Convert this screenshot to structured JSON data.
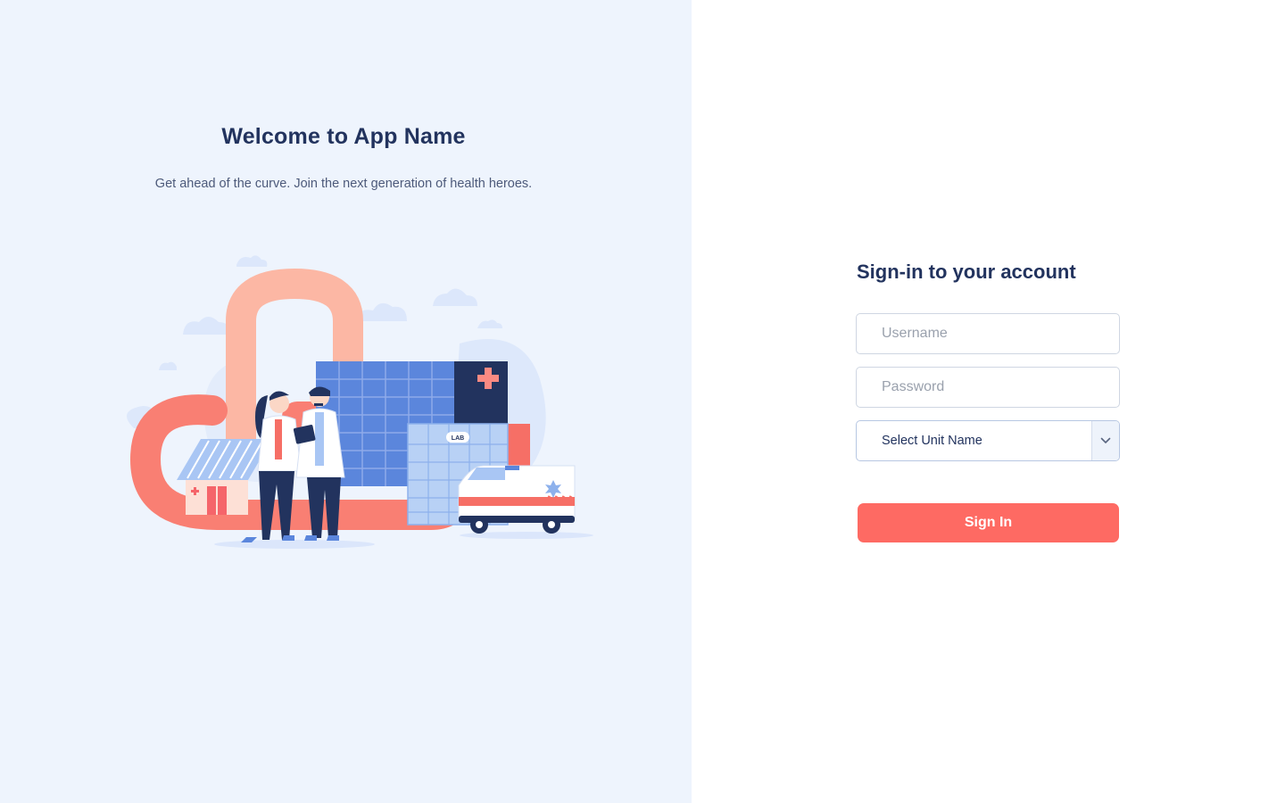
{
  "welcome": {
    "title": "Welcome to App Name",
    "subtitle": "Get ahead of the curve. Join the next generation of health heroes."
  },
  "illustration": {
    "lab_sign": "LAB",
    "icons": [
      "medical-cross-icon",
      "star-of-life-icon",
      "doctor-figure",
      "nurse-figure",
      "ambulance-icon",
      "hospital-building",
      "house-clinic"
    ]
  },
  "signin": {
    "title": "Sign-in to your account",
    "username": {
      "placeholder": "Username",
      "value": ""
    },
    "password": {
      "placeholder": "Password",
      "value": ""
    },
    "unit_select": {
      "selected": "Select Unit Name",
      "icon": "chevron-down-icon"
    },
    "submit_label": "Sign In"
  },
  "colors": {
    "left_background": "#eef4fd",
    "heading": "#22335e",
    "accent": "#fe6a63",
    "navy": "#2a3a6b",
    "hospital_blue": "#5b86dc"
  }
}
